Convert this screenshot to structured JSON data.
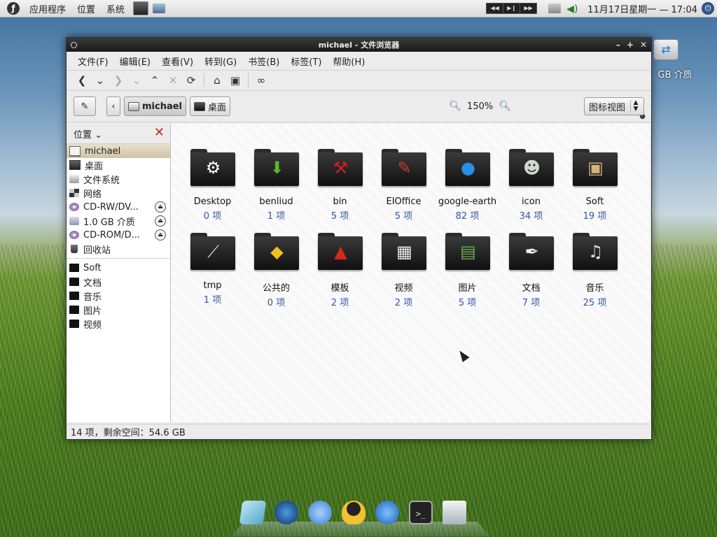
{
  "top_panel": {
    "menus": [
      "应用程序",
      "位置",
      "系统"
    ],
    "clock": "11月17日星期一 — 17:04"
  },
  "desktop": {
    "drive_label": "GB 介质"
  },
  "window": {
    "title": "michael - 文件浏览器",
    "menu": [
      "文件(F)",
      "编辑(E)",
      "查看(V)",
      "转到(G)",
      "书签(B)",
      "标签(T)",
      "帮助(H)"
    ],
    "location": {
      "crumbs": [
        "michael",
        "桌面"
      ],
      "zoom": "150%",
      "view_mode": "图标视图"
    },
    "sidebar": {
      "header": "位置",
      "places": [
        {
          "label": "michael",
          "icon": "home-icon",
          "selected": true
        },
        {
          "label": "桌面",
          "icon": "desktop-icon"
        },
        {
          "label": "文件系统",
          "icon": "filesystem-icon"
        },
        {
          "label": "网络",
          "icon": "network-icon"
        },
        {
          "label": "CD-RW/DV...",
          "icon": "cd-icon",
          "eject": true
        },
        {
          "label": "1.0 GB 介质",
          "icon": "usb-drive-icon",
          "eject": true
        },
        {
          "label": "CD-ROM/D...",
          "icon": "cd-icon",
          "eject": true
        },
        {
          "label": "回收站",
          "icon": "trash-icon"
        }
      ],
      "bookmarks": [
        "Soft",
        "文档",
        "音乐",
        "图片",
        "视频"
      ]
    },
    "files": [
      {
        "name": "Desktop",
        "count": "0 项",
        "emblem": "desktop-emblem-icon"
      },
      {
        "name": "benliud",
        "count": "1 项",
        "emblem": "download-arrow-icon"
      },
      {
        "name": "bin",
        "count": "5 项",
        "emblem": "hammer-icon"
      },
      {
        "name": "EIOffice",
        "count": "5 项",
        "emblem": "office-tools-icon"
      },
      {
        "name": "google-earth",
        "count": "82 项",
        "emblem": "globe-icon"
      },
      {
        "name": "icon",
        "count": "34 项",
        "emblem": "alien-face-icon"
      },
      {
        "name": "Soft",
        "count": "19 项",
        "emblem": "package-box-icon"
      },
      {
        "name": "tmp",
        "count": "1 项",
        "emblem": "sword-icon"
      },
      {
        "name": "公共的",
        "count": "0 项",
        "emblem": "pedestrian-sign-icon"
      },
      {
        "name": "模板",
        "count": "2 项",
        "emblem": "warning-triangle-icon"
      },
      {
        "name": "视频",
        "count": "2 项",
        "emblem": "clapperboard-icon"
      },
      {
        "name": "图片",
        "count": "5 项",
        "emblem": "photos-icon"
      },
      {
        "name": "文档",
        "count": "7 项",
        "emblem": "document-pen-icon"
      },
      {
        "name": "音乐",
        "count": "25 项",
        "emblem": "headphones-icon"
      }
    ],
    "status": "14 项，剩余空间：54.6 GB"
  }
}
